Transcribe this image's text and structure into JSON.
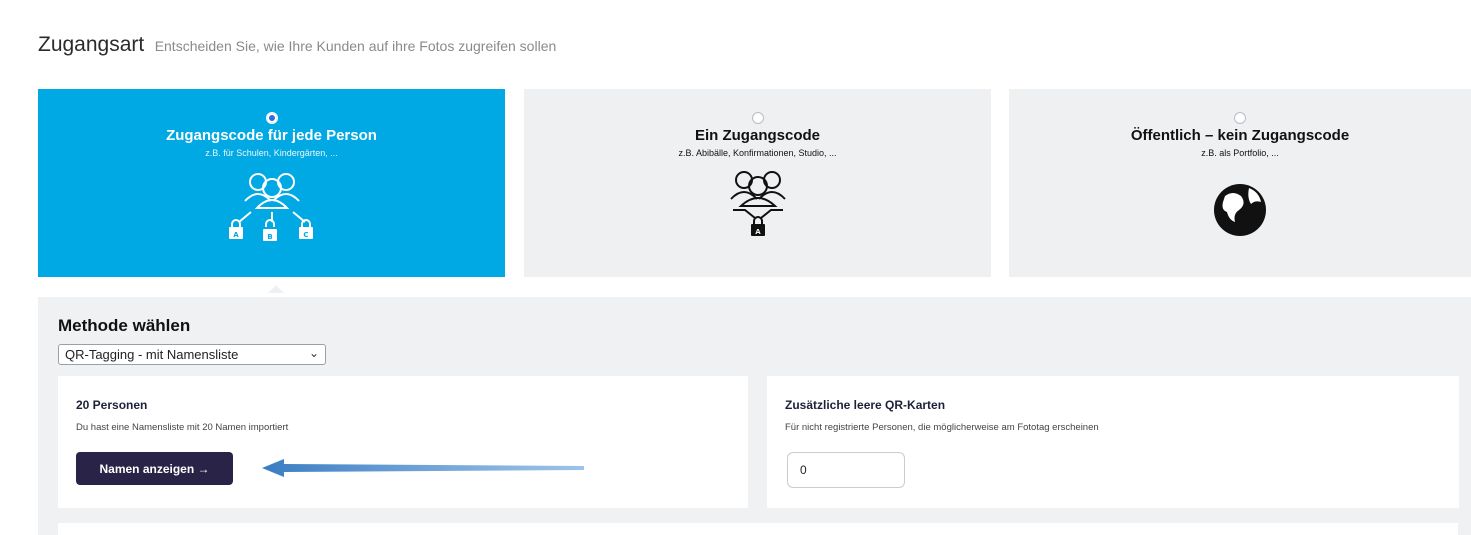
{
  "header": {
    "title": "Zugangsart",
    "subtitle": "Entscheiden Sie, wie Ihre Kunden auf ihre Fotos zugreifen sollen"
  },
  "cards": [
    {
      "title": "Zugangscode für jede Person",
      "subtitle": "z.B. für Schulen, Kindergärten, ...",
      "icon": "group-multi-lock-icon",
      "selected": true,
      "lock_letters": [
        "A",
        "B",
        "C"
      ]
    },
    {
      "title": "Ein Zugangscode",
      "subtitle": "z.B. Abibälle, Konfirmationen, Studio, ...",
      "icon": "group-single-lock-icon",
      "selected": false,
      "lock_letters": [
        "A"
      ]
    },
    {
      "title": "Öffentlich – kein Zugangscode",
      "subtitle": "z.B. als Portfolio, ...",
      "icon": "globe-icon",
      "selected": false
    }
  ],
  "method": {
    "title": "Methode wählen",
    "selected_option": "QR-Tagging - mit Namensliste"
  },
  "persons_box": {
    "title": "20 Personen",
    "description": "Du hast eine Namensliste mit 20 Namen importiert",
    "button_label": "Namen anzeigen →"
  },
  "qr_box": {
    "title": "Zusätzliche leere QR-Karten",
    "description": "Für nicht registrierte Personen, die möglicherweise am Fototag erscheinen",
    "value": "0"
  },
  "colors": {
    "accent": "#00a8e4",
    "button": "#2a2348",
    "panel": "#f0f1f3",
    "arrow": "#3a7cc2"
  }
}
